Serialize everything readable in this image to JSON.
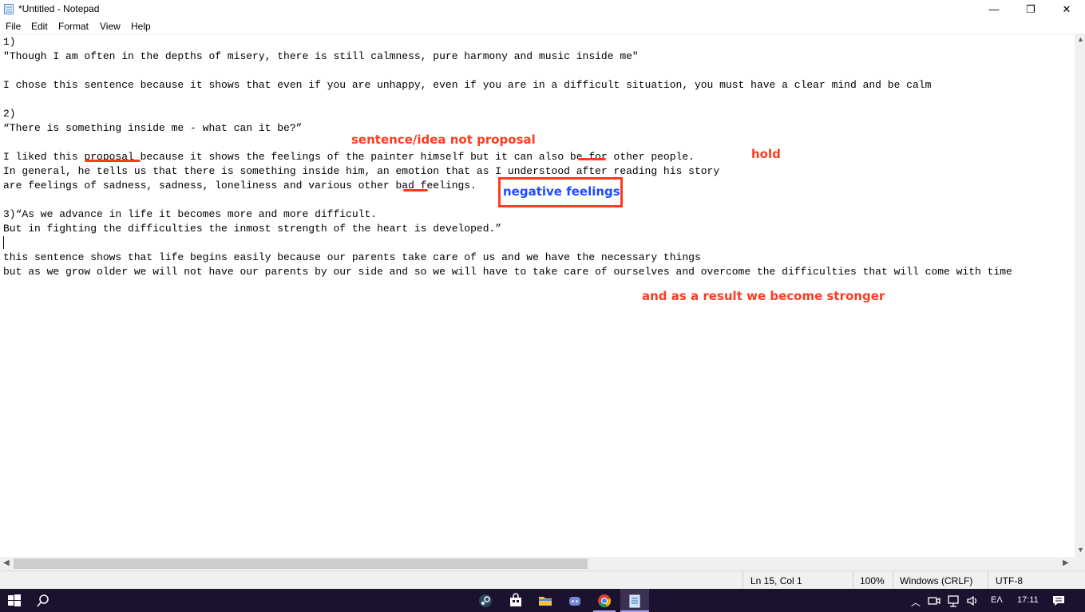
{
  "window": {
    "title": "*Untitled - Notepad",
    "minimize_glyph": "—",
    "maximize_glyph": "❐",
    "close_glyph": "✕"
  },
  "menu": [
    "File",
    "Edit",
    "Format",
    "View",
    "Help"
  ],
  "lines": [
    "1)",
    "\"Though I am often in the depths of misery, there is still calmness, pure harmony and music inside me\"",
    "",
    "I chose this sentence because it shows that even if you are unhappy, even if you are in a difficult situation, you must have a clear mind and be calm",
    "",
    "2)",
    "“There is something inside me - what can it be?”",
    "",
    "I liked this proposal because it shows the feelings of the painter himself but it can also be for other people.",
    "In general, he tells us that there is something inside him, an emotion that as I understood after reading his story",
    "are feelings of sadness, sadness, loneliness and various other bad feelings.",
    "",
    "3)“As we advance in life it becomes more and more difficult.",
    "But in fighting the difficulties the inmost strength of the heart is developed.”",
    "",
    "",
    "this sentence shows that life begins easily because our parents take care of us and we have the necessary things",
    "but as we grow older we will not have our parents by our side and so we will have to take care of ourselves and overcome the difficulties that will come with time"
  ],
  "annotations": {
    "sentence_idea": "sentence/idea not proposal",
    "hold": "hold",
    "negative_feelings": "negative feelings",
    "stronger": "and as a result we become stronger"
  },
  "status": {
    "position": "Ln 15, Col 1",
    "zoom": "100%",
    "line_ending": "Windows (CRLF)",
    "encoding": "UTF-8"
  },
  "taskbar": {
    "language": "ΕΛ",
    "time": "17:11"
  },
  "colors": {
    "annotation_red": "#ff3b1f",
    "annotation_blue": "#1f4bff",
    "taskbar_bg": "#1b1230"
  }
}
